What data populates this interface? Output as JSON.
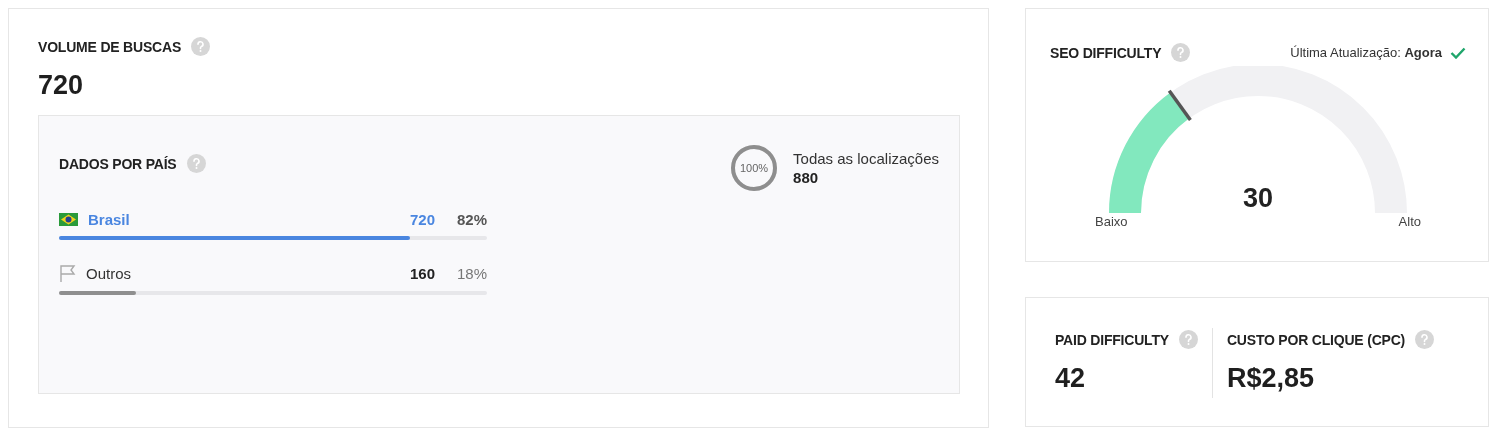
{
  "search_volume": {
    "title": "VOLUME DE BUSCAS",
    "value": "720",
    "by_country": {
      "title": "DADOS POR PAÍS",
      "countries": [
        {
          "kind": "brazil",
          "name": "Brasil",
          "volume": "720",
          "share": "82%",
          "level": 0.82,
          "highlighted": true,
          "color": "#4a86e0"
        },
        {
          "kind": "generic",
          "name": "Outros",
          "volume": "160",
          "share": "18%",
          "level": 0.18,
          "highlighted": false,
          "color": "#8f8f8f"
        }
      ],
      "all_locations": {
        "ring_label": "100%",
        "label": "Todas as localizações",
        "value": "880"
      }
    }
  },
  "seo_difficulty": {
    "title": "SEO DIFFICULTY",
    "updated_label": "Última Atualização:",
    "updated_value": "Agora",
    "verified": true,
    "value": "30",
    "low_label": "Baixo",
    "high_label": "Alto"
  },
  "paid_difficulty": {
    "title": "PAID DIFFICULTY",
    "value": "42"
  },
  "cpc": {
    "title": "CUSTO POR CLIQUE (CPC)",
    "value": "R$2,85"
  }
}
